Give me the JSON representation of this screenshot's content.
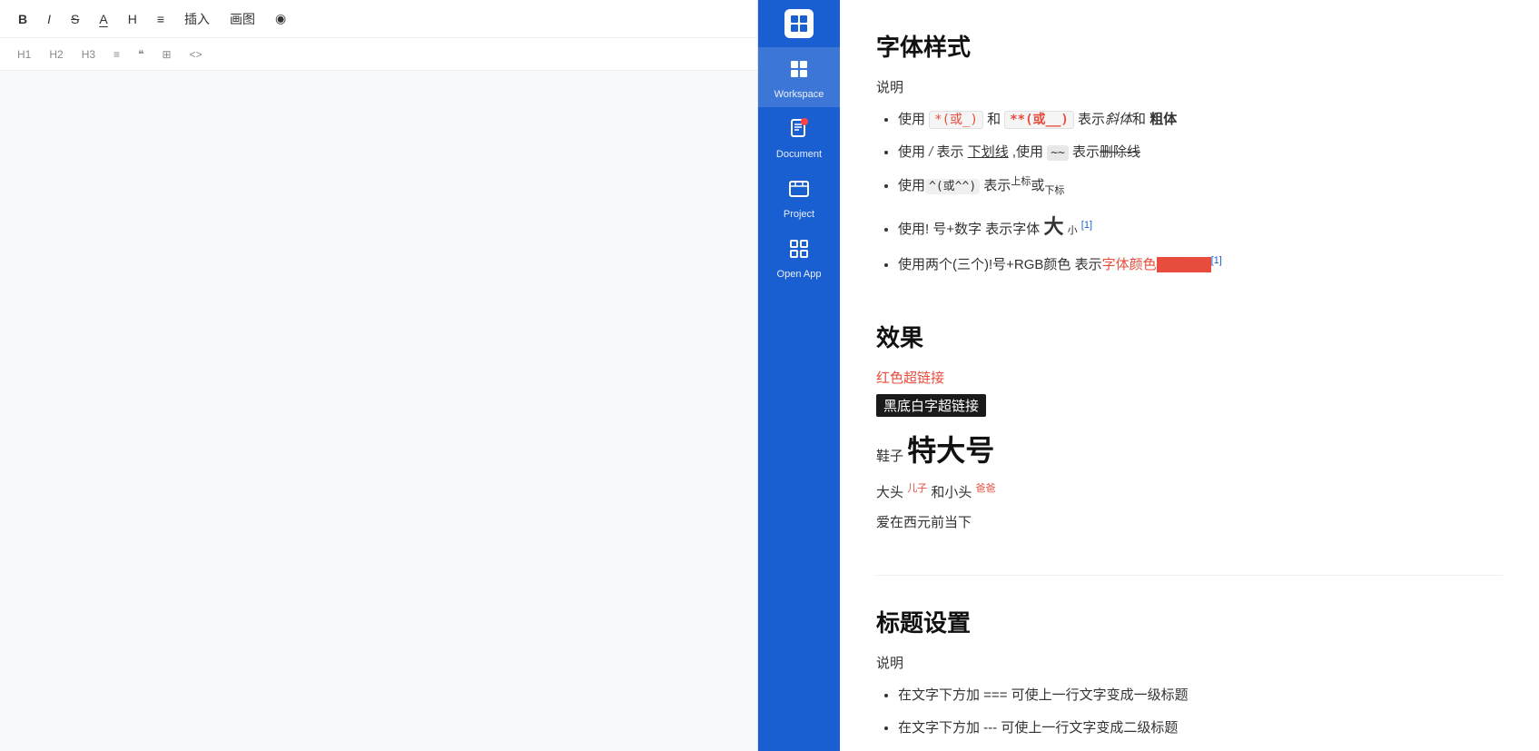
{
  "editor": {
    "toolbar": {
      "bold": "B",
      "italic": "I",
      "strike": "S",
      "font_color": "A",
      "heading": "H",
      "list": "≡",
      "insert": "插入",
      "image": "画图",
      "view": "◉"
    },
    "sub_toolbar": {
      "h1": "H1",
      "h2": "H2",
      "h3": "H3",
      "bullet": "≡",
      "quote": "❝",
      "table": "⊞",
      "code": "<>"
    }
  },
  "nav": {
    "logo_icon": "◧",
    "items": [
      {
        "id": "workspace",
        "label": "Workspace",
        "icon": "workspace",
        "active": true,
        "badge": false
      },
      {
        "id": "document",
        "label": "Document",
        "icon": "document",
        "active": false,
        "badge": true
      },
      {
        "id": "project",
        "label": "Project",
        "icon": "project",
        "active": false,
        "badge": false
      },
      {
        "id": "open-app",
        "label": "Open App",
        "icon": "open-app",
        "active": false,
        "badge": false
      }
    ]
  },
  "content": {
    "section1": {
      "title": "字体样式",
      "subtitle": "说明",
      "items": [
        {
          "text_parts": [
            {
              "type": "text",
              "value": "使用 "
            },
            {
              "type": "code-red",
              "value": "*(或_)"
            },
            {
              "type": "text",
              "value": " 和 "
            },
            {
              "type": "code-red-bold",
              "value": "** (或__)"
            },
            {
              "type": "text",
              "value": " 表示"
            },
            {
              "type": "italic",
              "value": "斜体"
            },
            {
              "type": "text",
              "value": "和 "
            },
            {
              "type": "bold",
              "value": "粗体"
            }
          ]
        },
        {
          "text": "使用 / 表示 下划线 ,使用 ~~ 表示删除线"
        },
        {
          "text": "使用^(或^^) 表示上标或下标"
        },
        {
          "text": "使用! 号+数字 表示字体 大 小"
        },
        {
          "text": "使用两个(三个)!号+RGB颜色 表示字体颜色(背景颜色)"
        }
      ]
    },
    "section2": {
      "title": "效果",
      "red_link": "红色超链接",
      "black_link": "黑底白字超链接",
      "shoe_label": "鞋子",
      "shoe_large": "特大号",
      "head_text": "大头",
      "son_text": "儿子",
      "middle_text": "和小头",
      "dad_text": "爸爸",
      "love_text": "爱在西元前当下"
    },
    "section3": {
      "title": "标题设置",
      "subtitle": "说明",
      "items": [
        {
          "text": "在文字下方加 === 可使上一行文字变成一级标题"
        },
        {
          "text": "在文字下方加 --- 可使上一行文字变成二级标题"
        }
      ]
    }
  }
}
